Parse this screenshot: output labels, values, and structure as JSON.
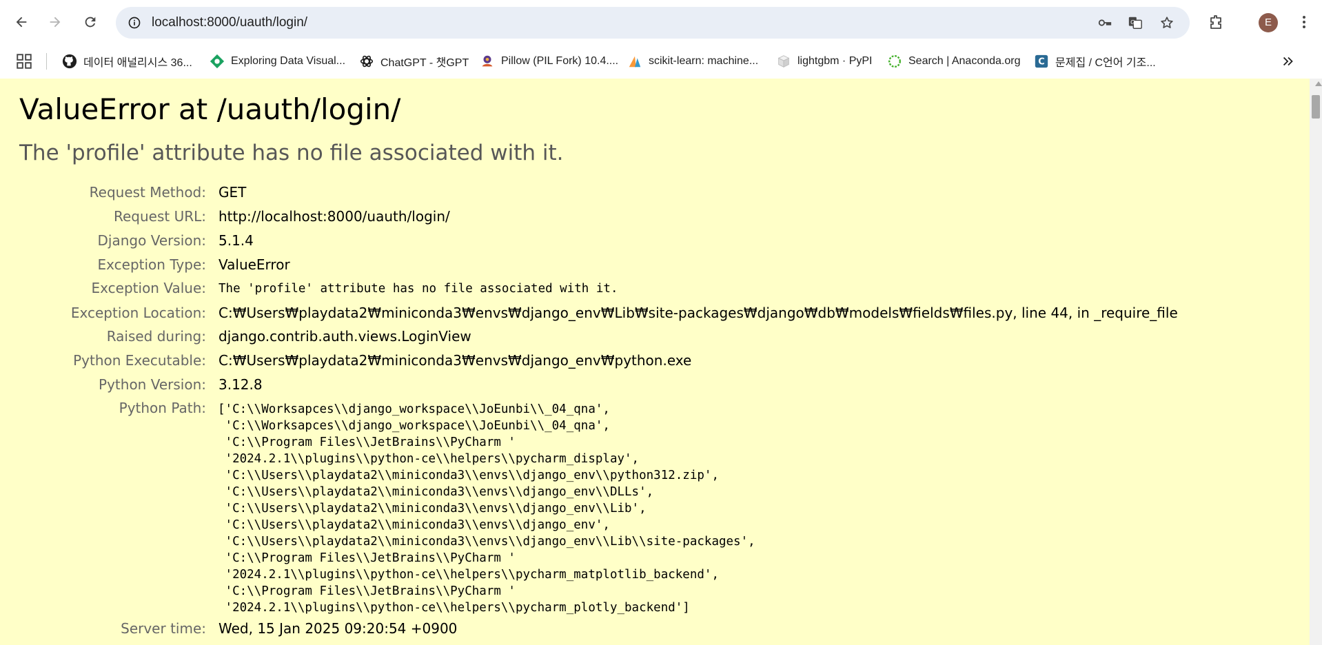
{
  "browser": {
    "url": "localhost:8000/uauth/login/",
    "avatar_letter": "E",
    "bookmarks": [
      {
        "label": "데이터 애널리시스 36...",
        "icon": "github-icon"
      },
      {
        "label": "Exploring Data Visual...",
        "icon": "green-diamond-icon"
      },
      {
        "label": "ChatGPT - 챗GPT",
        "icon": "openai-icon"
      },
      {
        "label": "Pillow (PIL Fork) 10.4....",
        "icon": "pillow-icon"
      },
      {
        "label": "scikit-learn: machine...",
        "icon": "scikit-learn-icon"
      },
      {
        "label": "lightgbm · PyPI",
        "icon": "pypi-icon"
      },
      {
        "label": "Search | Anaconda.org",
        "icon": "anaconda-icon"
      },
      {
        "label": "문제집 / C언어 기조...",
        "icon": "c-icon"
      }
    ]
  },
  "error": {
    "title": "ValueError at /uauth/login/",
    "subtitle": "The 'profile' attribute has no file associated with it.",
    "meta": {
      "request_method": {
        "label": "Request Method:",
        "value": "GET"
      },
      "request_url": {
        "label": "Request URL:",
        "value": "http://localhost:8000/uauth/login/"
      },
      "django_version": {
        "label": "Django Version:",
        "value": "5.1.4"
      },
      "exception_type": {
        "label": "Exception Type:",
        "value": "ValueError"
      },
      "exception_value": {
        "label": "Exception Value:",
        "value": "The 'profile' attribute has no file associated with it."
      },
      "exception_location": {
        "label": "Exception Location:",
        "value": "C:₩Users₩playdata2₩miniconda3₩envs₩django_env₩Lib₩site-packages₩django₩db₩models₩fields₩files.py, line 44, in _require_file"
      },
      "raised_during": {
        "label": "Raised during:",
        "value": "django.contrib.auth.views.LoginView"
      },
      "python_executable": {
        "label": "Python Executable:",
        "value": "C:₩Users₩playdata2₩miniconda3₩envs₩django_env₩python.exe"
      },
      "python_version": {
        "label": "Python Version:",
        "value": "3.12.8"
      },
      "python_path": {
        "label": "Python Path:",
        "value": "['C:\\\\Worksapces\\\\django_workspace\\\\JoEunbi\\\\_04_qna',\n 'C:\\\\Worksapces\\\\django_workspace\\\\JoEunbi\\\\_04_qna',\n 'C:\\\\Program Files\\\\JetBrains\\\\PyCharm '\n '2024.2.1\\\\plugins\\\\python-ce\\\\helpers\\\\pycharm_display',\n 'C:\\\\Users\\\\playdata2\\\\miniconda3\\\\envs\\\\django_env\\\\python312.zip',\n 'C:\\\\Users\\\\playdata2\\\\miniconda3\\\\envs\\\\django_env\\\\DLLs',\n 'C:\\\\Users\\\\playdata2\\\\miniconda3\\\\envs\\\\django_env\\\\Lib',\n 'C:\\\\Users\\\\playdata2\\\\miniconda3\\\\envs\\\\django_env',\n 'C:\\\\Users\\\\playdata2\\\\miniconda3\\\\envs\\\\django_env\\\\Lib\\\\site-packages',\n 'C:\\\\Program Files\\\\JetBrains\\\\PyCharm '\n '2024.2.1\\\\plugins\\\\python-ce\\\\helpers\\\\pycharm_matplotlib_backend',\n 'C:\\\\Program Files\\\\JetBrains\\\\PyCharm '\n '2024.2.1\\\\plugins\\\\python-ce\\\\helpers\\\\pycharm_plotly_backend']"
      },
      "server_time": {
        "label": "Server time:",
        "value": "Wed, 15 Jan 2025 09:20:54 +0900"
      }
    }
  }
}
